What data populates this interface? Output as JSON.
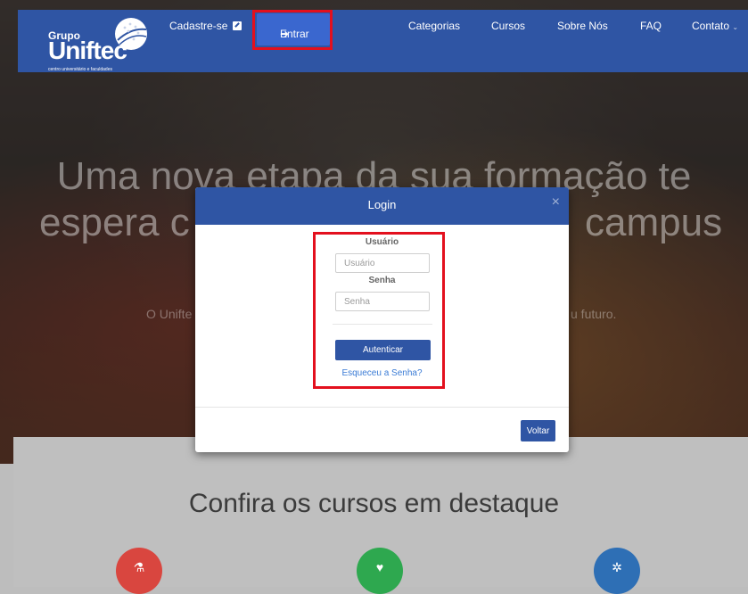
{
  "navbar": {
    "logo": {
      "grupo": "Grupo",
      "name": "Uniftec",
      "tagline": "centro universitário e faculdades"
    },
    "items": {
      "register": "Cadastre-se",
      "enter": "Entrar",
      "categories": "Categorias",
      "courses": "Cursos",
      "about": "Sobre Nós",
      "faq": "FAQ",
      "contact": "Contato"
    }
  },
  "hero": {
    "title_line1": "Uma nova etapa da sua formação te",
    "title_line2_left": "espera c",
    "title_line2_right": "campus",
    "subtitle_left": "O Unifte",
    "subtitle_right": "u futuro."
  },
  "modal": {
    "title": "Login",
    "close": "×",
    "username_label": "Usuário",
    "username_placeholder": "Usuário",
    "username_value": "",
    "password_label": "Senha",
    "password_placeholder": "Senha",
    "password_value": "",
    "authenticate": "Autenticar",
    "forgot": "Esqueceu a Senha?",
    "back": "Voltar"
  },
  "featured": {
    "title": "Confira os cursos em destaque",
    "icons": [
      {
        "name": "flask-icon",
        "color": "#d9463f"
      },
      {
        "name": "heart-icon",
        "color": "#2ea84f"
      },
      {
        "name": "bug-icon",
        "color": "#2e6fb5"
      }
    ]
  },
  "colors": {
    "brand": "#2f55a4",
    "highlight": "#e3101e"
  }
}
